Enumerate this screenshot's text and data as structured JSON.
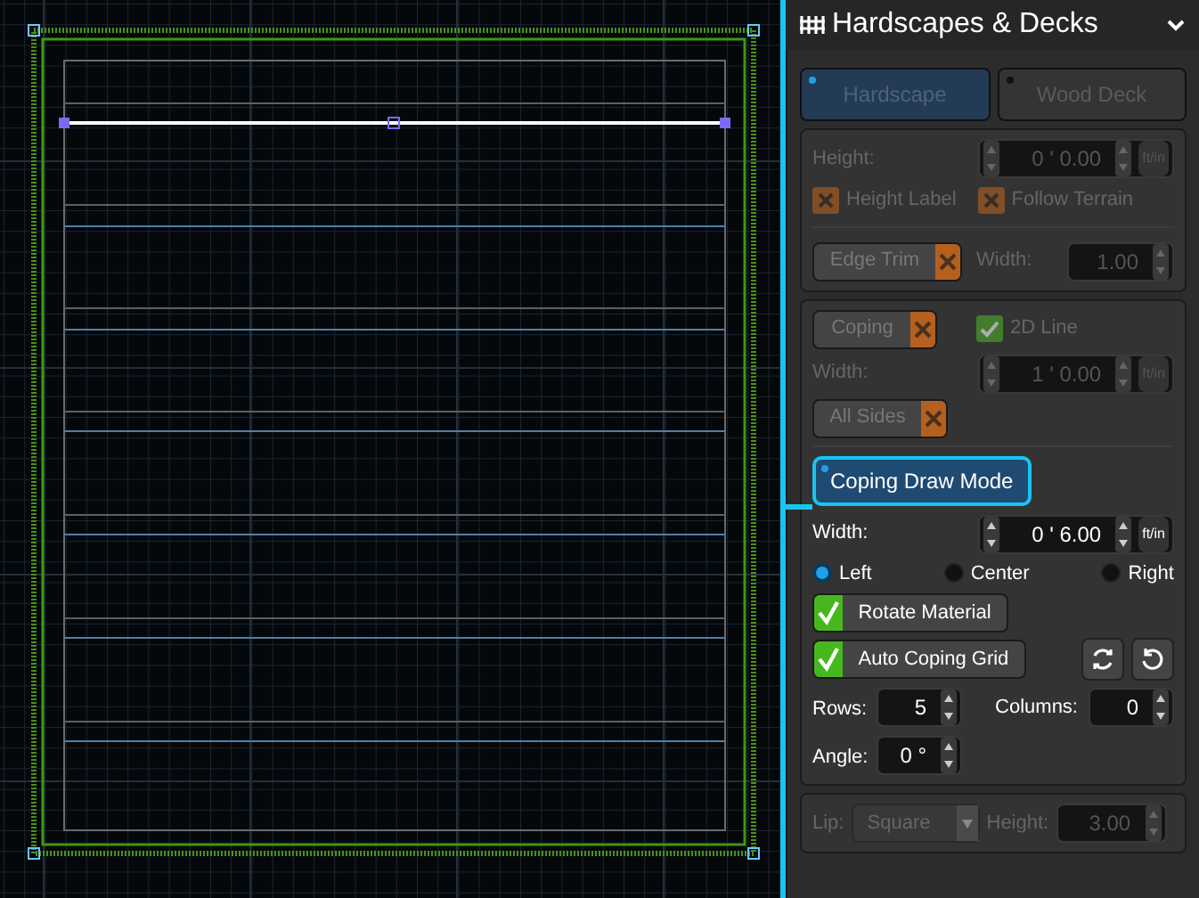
{
  "panel": {
    "title": "Hardscapes & Decks"
  },
  "mode_buttons": [
    {
      "label": "Hardscape",
      "selected": true
    },
    {
      "label": "Wood Deck",
      "selected": false
    }
  ],
  "height_section": {
    "disabled": true,
    "height": {
      "label": "Height:",
      "value": "0 ' 0.00",
      "unit": "ft/in"
    },
    "checkboxes": [
      {
        "label": "Height Label",
        "checked": false
      },
      {
        "label": "Follow Terrain",
        "checked": false
      }
    ],
    "edge_trim": {
      "label": "Edge Trim",
      "checked": false
    },
    "width": {
      "label": "Width:",
      "value": "1.00"
    }
  },
  "coping_section": {
    "options": {
      "disabled": true,
      "coping": {
        "label": "Coping",
        "checked": false
      },
      "line_2d": {
        "label": "2D Line",
        "checked": true
      },
      "width": {
        "label": "Width:",
        "value": "1 ' 0.00",
        "unit": "ft/in"
      },
      "all_sides": {
        "label": "All Sides",
        "checked": false
      }
    },
    "draw_mode": {
      "label": "Coping Draw Mode",
      "selected": true
    },
    "width": {
      "label": "Width:",
      "value": "0 ' 6.00",
      "unit": "ft/in"
    },
    "alignment": [
      {
        "label": "Left",
        "selected": true
      },
      {
        "label": "Center",
        "selected": false
      },
      {
        "label": "Right",
        "selected": false
      }
    ],
    "toggles": [
      {
        "label": "Rotate Material",
        "checked": true
      },
      {
        "label": "Auto Coping Grid",
        "checked": true
      }
    ],
    "rows": {
      "label": "Rows:",
      "value": "5"
    },
    "columns": {
      "label": "Columns:",
      "value": "0"
    },
    "angle": {
      "label": "Angle:",
      "value": "0 °"
    }
  },
  "lip_section": {
    "disabled": true,
    "lip": {
      "label": "Lip:",
      "value": "Square"
    },
    "height": {
      "label": "Height:",
      "value": "3.00"
    }
  }
}
